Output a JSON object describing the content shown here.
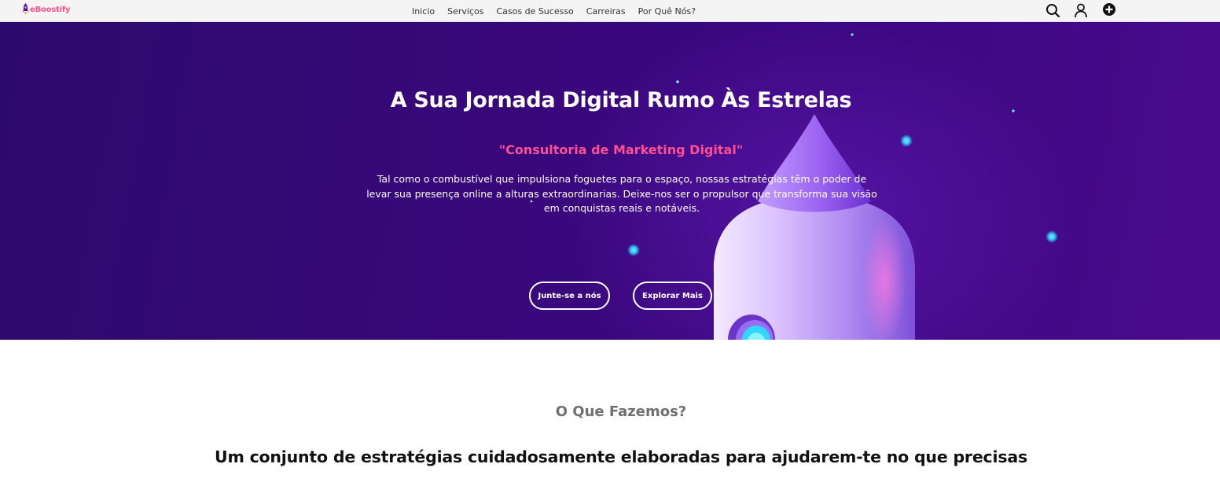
{
  "header": {
    "logo_text": "eBoostify",
    "nav": [
      {
        "label": "Inicio"
      },
      {
        "label": "Serviços"
      },
      {
        "label": "Casos de Sucesso"
      },
      {
        "label": "Carreiras"
      },
      {
        "label": "Por Quê Nós?"
      }
    ],
    "icons": [
      "search-icon",
      "user-icon",
      "plus-circle-icon"
    ]
  },
  "hero": {
    "title": "A Sua Jornada Digital Rumo Às Estrelas",
    "subtitle": "\"Consultoria de Marketing Digital\"",
    "description": "Tal como o combustível que impulsiona foguetes para o espaço, nossas estratégias têm o poder de levar sua presença online a alturas extraordinarias. Deixe-nos ser o propulsor que transforma sua visão em conquistas reais e notáveis.",
    "buttons": {
      "join_label": "Junte-se a nós",
      "explore_label": "Explorar Mais"
    }
  },
  "section": {
    "kicker": "O Que Fazemos?",
    "heading": "Um conjunto de estratégias cuidadosamente elaboradas para ajudarem-te no que precisas"
  },
  "colors": {
    "accent_pink": "#ff4f93",
    "hero_purple": "#3a0a7e",
    "star_cyan": "#2fd0ff",
    "text_dark": "#111111",
    "text_muted": "#707070"
  }
}
